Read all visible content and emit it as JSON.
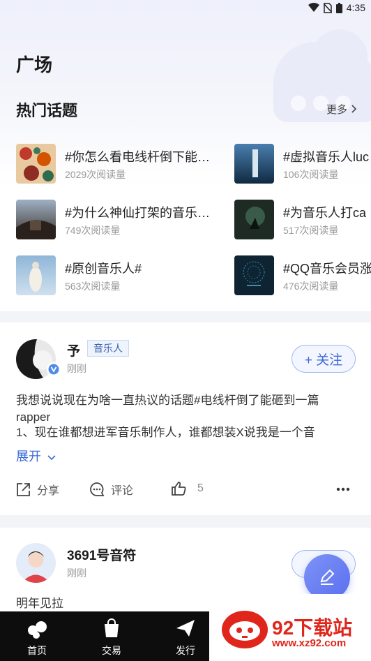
{
  "status_bar": {
    "time": "4:35"
  },
  "page": {
    "title": "广场"
  },
  "hot_topics": {
    "title": "热门话题",
    "more_label": "更多",
    "items": [
      {
        "title": "#你怎么看电线杆倒下能…",
        "count": "2029次阅读量"
      },
      {
        "title": "#虚拟音乐人luc",
        "count": "106次阅读量"
      },
      {
        "title": "#为什么神仙打架的音乐…",
        "count": "749次阅读量"
      },
      {
        "title": "#为音乐人打ca",
        "count": "517次阅读量"
      },
      {
        "title": "#原创音乐人#",
        "count": "563次阅读量"
      },
      {
        "title": "#QQ音乐会员涨",
        "count": "476次阅读量"
      }
    ]
  },
  "posts": [
    {
      "user_name": "予",
      "user_tag": "音乐人",
      "time": "刚刚",
      "follow_label": "+ 关注",
      "text_lines": [
        "我想说说现在为啥一直热议的话题#电线杆倒了能砸到一篇",
        "rapper",
        "1、现在谁都想进军音乐制作人，谁都想装X说我是一个音"
      ],
      "expand_label": "展开",
      "share_label": "分享",
      "comment_label": "评论",
      "like_count": "5"
    },
    {
      "user_name": "3691号音符",
      "time": "刚刚",
      "text": "明年见拉"
    }
  ],
  "tabbar": {
    "items": [
      {
        "label": "首页"
      },
      {
        "label": "交易"
      },
      {
        "label": "发行"
      }
    ]
  },
  "watermark": {
    "brand": "92下载站",
    "url": "www.xz92.com"
  },
  "colors": {
    "accent": "#3a69d8",
    "fab": "#6a7ff2",
    "tabbar": "#0d0d0d",
    "watermark": "#e0261b"
  }
}
